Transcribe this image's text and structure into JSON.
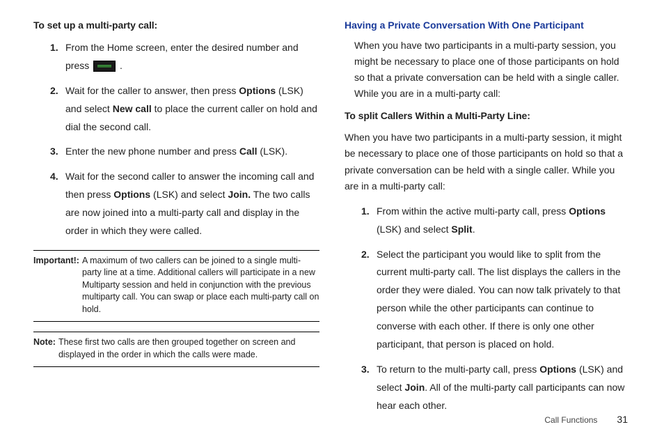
{
  "left": {
    "heading": "To set up a multi-party call:",
    "steps": {
      "s1a": "From the Home screen, enter the desired number and press ",
      "s1b": " .",
      "s2a": "Wait for the caller to answer, then press ",
      "s2b": "Options",
      "s2c": " (LSK) and select ",
      "s2d": "New call",
      "s2e": " to place the current caller on hold and dial the second call.",
      "s3a": "Enter the new phone number and press ",
      "s3b": "Call",
      "s3c": " (LSK).",
      "s4a": "Wait for the second caller to answer the incoming call and then press ",
      "s4b": "Options",
      "s4c": " (LSK) and select ",
      "s4d": "Join.",
      "s4e": " The two calls are now joined into a multi-party call and display in the order in which they were called."
    },
    "important": {
      "label": "Important!:",
      "body": "A maximum of two callers can be joined to a single multi-party line at a time. Additional callers will participate in a new Multiparty session and held in conjunction with the previous multiparty call. You can swap or place each multi-party call on hold."
    },
    "note": {
      "label": "Note:",
      "body": "These first two calls are then grouped together on screen and displayed in the order in which the calls were made."
    }
  },
  "right": {
    "heading": "Having a Private Conversation With One Participant",
    "intro": "When you have two participants in a multi-party session, you might be necessary to place one of those participants on hold so that a private conversation can be held with a single caller. While you are in a multi-party call:",
    "subheading": "To split Callers Within a Multi-Party Line:",
    "subintro": "When you have two participants in a multi-party session, it might be necessary to place one of those participants on hold so that a private conversation can be held with a single caller. While you are in a multi-party call:",
    "steps": {
      "s1a": "From within the active multi-party call, press ",
      "s1b": "Options",
      "s1c": " (LSK) and select ",
      "s1d": "Split",
      "s1e": ".",
      "s2": "Select the participant you would like to split from the current multi-party call. The list displays the callers in the order they were dialed. You can now talk privately to that person while the other participants can continue to converse with each other. If there is only one other participant, that person is placed on hold.",
      "s3a": "To return to the multi-party call, press ",
      "s3b": "Options",
      "s3c": " (LSK) and select ",
      "s3d": "Join",
      "s3e": ". All of the multi-party call participants can now hear each other."
    }
  },
  "footer": {
    "section": "Call Functions",
    "page": "31"
  }
}
